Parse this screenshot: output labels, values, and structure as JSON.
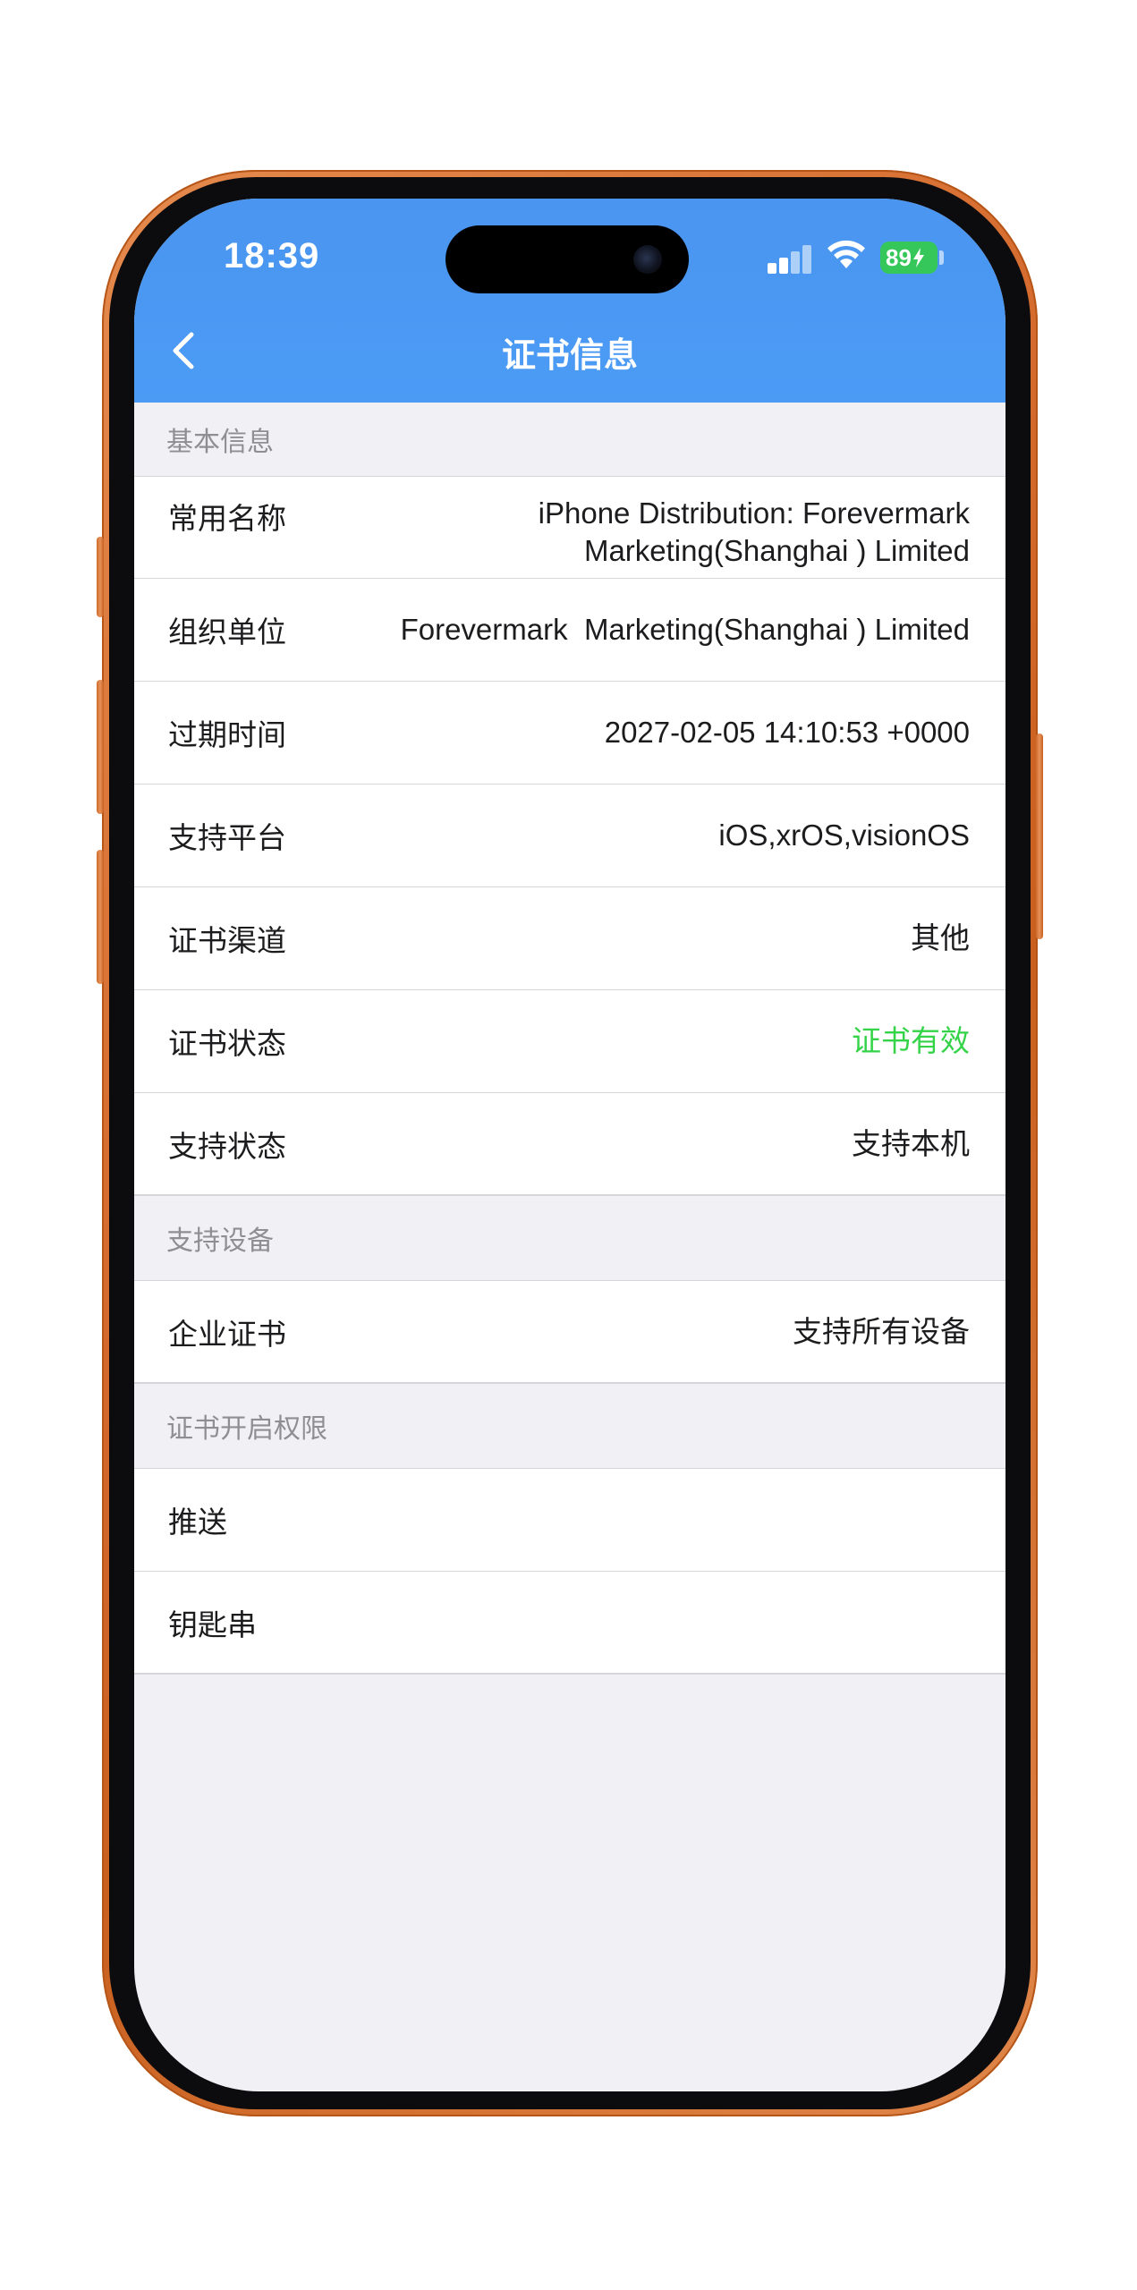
{
  "status_bar": {
    "time": "18:39",
    "battery": "89"
  },
  "nav": {
    "title": "证书信息"
  },
  "sections": {
    "basic": {
      "header": "基本信息",
      "rows": [
        {
          "label": "常用名称",
          "value_line1": "iPhone Distribution: Forevermark",
          "value_line2": "Marketing(Shanghai ) Limited"
        },
        {
          "label": "组织单位",
          "value": "Forevermark  Marketing(Shanghai ) Limited"
        },
        {
          "label": "过期时间",
          "value": "2027-02-05 14:10:53 +0000"
        },
        {
          "label": "支持平台",
          "value": "iOS,xrOS,visionOS"
        },
        {
          "label": "证书渠道",
          "value": "其他"
        },
        {
          "label": "证书状态",
          "value": "证书有效",
          "value_color": "#34d348"
        },
        {
          "label": "支持状态",
          "value": "支持本机"
        }
      ]
    },
    "devices": {
      "header": "支持设备",
      "rows": [
        {
          "label": "企业证书",
          "value": "支持所有设备"
        }
      ]
    },
    "permissions": {
      "header": "证书开启权限",
      "rows": [
        {
          "label": "推送"
        },
        {
          "label": "钥匙串"
        }
      ]
    }
  },
  "colors": {
    "header_blue": "#4a95f0",
    "frame_orange": "#d4692c",
    "valid_green": "#34d348",
    "background": "#f0f0f5"
  }
}
